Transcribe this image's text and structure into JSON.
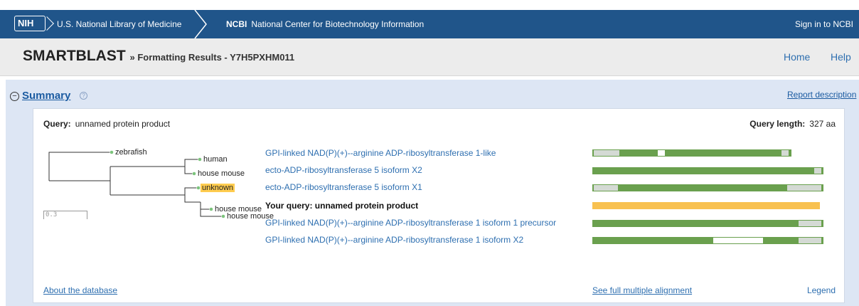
{
  "header": {
    "nih_logo": "NIH",
    "nlm": "U.S. National Library of Medicine",
    "ncbi_abbr": "NCBI",
    "ncbi_full": "National Center for Biotechnology Information",
    "signin": "Sign in to NCBI"
  },
  "subheader": {
    "title": "SMARTBLAST",
    "subtitle": "» Formatting Results - Y7H5PXHM011",
    "home": "Home",
    "help": "Help"
  },
  "summary": {
    "collapse_symbol": "−",
    "title": "Summary",
    "help_icon": "?",
    "report_link": "Report description",
    "query_label": "Query:",
    "query_value": "unnamed protein product",
    "length_label": "Query length:",
    "length_value": "327 aa",
    "tree_labels": [
      "zebrafish",
      "human",
      "house mouse",
      "unknown",
      "house mouse",
      "house mouse"
    ],
    "scale_label": "0.3",
    "hits": [
      {
        "label": "GPI-linked NAD(P)(+)--arginine ADP-ribosyltransferase 1-like",
        "is_query": false
      },
      {
        "label": "ecto-ADP-ribosyltransferase 5 isoform X2",
        "is_query": false
      },
      {
        "label": "ecto-ADP-ribosyltransferase 5 isoform X1",
        "is_query": false
      },
      {
        "label": "Your query: unnamed protein product",
        "is_query": true
      },
      {
        "label": "GPI-linked NAD(P)(+)--arginine ADP-ribosyltransferase 1 isoform 1 precursor",
        "is_query": false
      },
      {
        "label": "GPI-linked NAD(P)(+)--arginine ADP-ribosyltransferase 1 isoform X2",
        "is_query": false
      }
    ],
    "about_link": "About the database",
    "full_alignment_link": "See full multiple alignment",
    "legend_link": "Legend"
  },
  "colors": {
    "header_bg": "#20558a",
    "panel_bg": "#dde6f4",
    "alignment_bar": "#6aa04e",
    "query_bar": "#f8c150",
    "highlight": "#ffcc4f",
    "link": "#2e6fb0"
  }
}
